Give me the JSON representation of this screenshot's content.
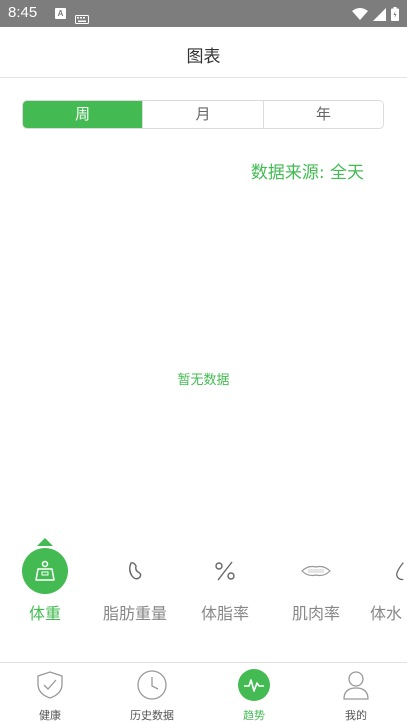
{
  "status_bar": {
    "time": "8:45",
    "notif_letter": "A"
  },
  "header": {
    "title": "图表"
  },
  "period_tabs": [
    {
      "label": "周",
      "active": true
    },
    {
      "label": "月",
      "active": false
    },
    {
      "label": "年",
      "active": false
    }
  ],
  "data_source": "数据来源: 全天",
  "empty_message": "暂无数据",
  "metrics": [
    {
      "label": "体重",
      "icon": "weight-icon",
      "active": true
    },
    {
      "label": "脂肪重量",
      "icon": "fat-drop-icon",
      "active": false
    },
    {
      "label": "体脂率",
      "icon": "percent-icon",
      "active": false
    },
    {
      "label": "肌肉率",
      "icon": "muscle-icon",
      "active": false
    },
    {
      "label": "体水",
      "icon": "water-drop-icon",
      "active": false
    }
  ],
  "bottom_tabs": [
    {
      "label": "健康",
      "icon": "shield-check-icon",
      "active": false
    },
    {
      "label": "历史数据",
      "icon": "clock-icon",
      "active": false
    },
    {
      "label": "趋势",
      "icon": "pulse-icon",
      "active": true
    },
    {
      "label": "我的",
      "icon": "person-icon",
      "active": false
    }
  ],
  "colors": {
    "accent": "#43bb52",
    "status_bar": "#7d7d7d"
  }
}
